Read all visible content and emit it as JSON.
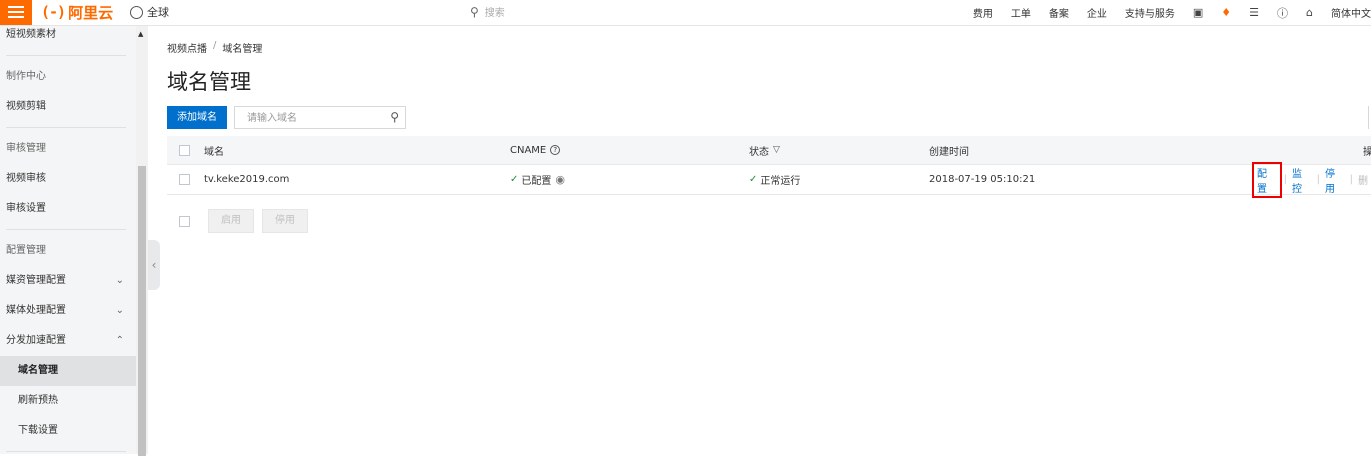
{
  "topbar": {
    "brand": "阿里云",
    "brand_mark": "(-)",
    "region": "全球",
    "search_placeholder": "搜索",
    "nav": [
      "费用",
      "工单",
      "备案",
      "企业",
      "支持与服务"
    ],
    "language": "简体中文",
    "icons": [
      "terminal-icon",
      "bell-icon",
      "cart-icon",
      "help-icon",
      "home-icon"
    ]
  },
  "sidebar": {
    "items": [
      {
        "label": "短视频素材",
        "kind": "item"
      },
      {
        "label": "制作中心",
        "kind": "group"
      },
      {
        "label": "视频剪辑",
        "kind": "item"
      },
      {
        "label": "审核管理",
        "kind": "group"
      },
      {
        "label": "视频审核",
        "kind": "item"
      },
      {
        "label": "审核设置",
        "kind": "item"
      },
      {
        "label": "配置管理",
        "kind": "group"
      },
      {
        "label": "媒资管理配置",
        "kind": "item",
        "chevron": "down"
      },
      {
        "label": "媒体处理配置",
        "kind": "item",
        "chevron": "down"
      },
      {
        "label": "分发加速配置",
        "kind": "item",
        "chevron": "up"
      },
      {
        "label": "域名管理",
        "kind": "sub",
        "active": true
      },
      {
        "label": "刷新预热",
        "kind": "sub"
      },
      {
        "label": "下载设置",
        "kind": "sub"
      }
    ]
  },
  "breadcrumb": [
    "视频点播",
    "域名管理"
  ],
  "page_title": "域名管理",
  "add_button": "添加域名",
  "domain_search_placeholder": "请输入域名",
  "table": {
    "headers": {
      "domain": "域名",
      "cname": "CNAME",
      "status": "状态",
      "created": "创建时间",
      "actions": "操"
    },
    "rows": [
      {
        "domain": "tv.keke2019.com",
        "cname": "已配置",
        "status": "正常运行",
        "created": "2018-07-19 05:10:21",
        "actions": [
          "配置",
          "监控",
          "停用",
          "删"
        ]
      }
    ]
  },
  "bulk": {
    "enable": "启用",
    "disable": "停用"
  },
  "colors": {
    "brand": "#ff6a00",
    "primary": "#0070cc",
    "highlight": "#e00000",
    "ok": "#1e8e3e"
  }
}
